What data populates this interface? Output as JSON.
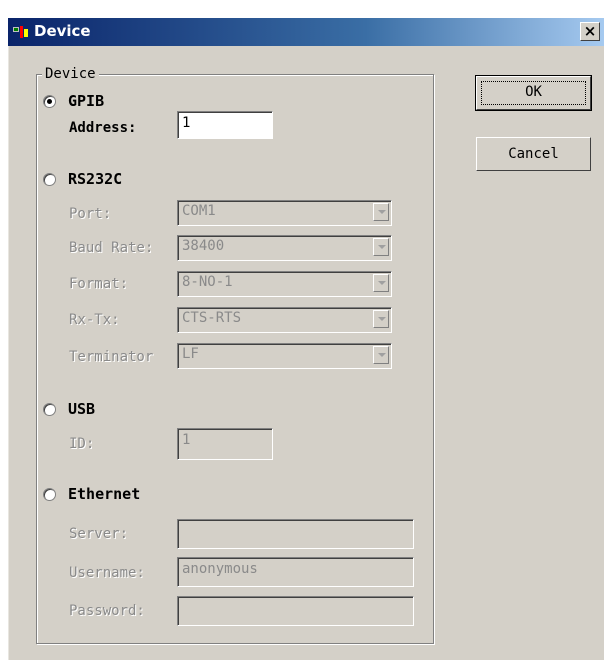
{
  "window": {
    "title": "Device",
    "close_label": "×"
  },
  "group": {
    "label": "Device"
  },
  "gpib": {
    "label": "GPIB",
    "selected": true,
    "address_label": "Address:",
    "address_value": "1"
  },
  "rs232c": {
    "label": "RS232C",
    "selected": false,
    "port_label": "Port:",
    "port_value": "COM1",
    "baud_label": "Baud Rate:",
    "baud_value": "38400",
    "format_label": "Format:",
    "format_value": "8-NO-1",
    "rxtx_label": "Rx-Tx:",
    "rxtx_value": "CTS-RTS",
    "terminator_label": "Terminator",
    "terminator_value": "LF"
  },
  "usb": {
    "label": "USB",
    "selected": false,
    "id_label": "ID:",
    "id_value": "1"
  },
  "ethernet": {
    "label": "Ethernet",
    "selected": false,
    "server_label": "Server:",
    "server_value": "",
    "username_label": "Username:",
    "username_value": "anonymous",
    "password_label": "Password:",
    "password_value": ""
  },
  "buttons": {
    "ok": "OK",
    "cancel": "Cancel"
  },
  "colors": {
    "dialog_bg": "#d4d0c8",
    "title_start": "#0a246a",
    "title_end": "#a6caf0"
  }
}
